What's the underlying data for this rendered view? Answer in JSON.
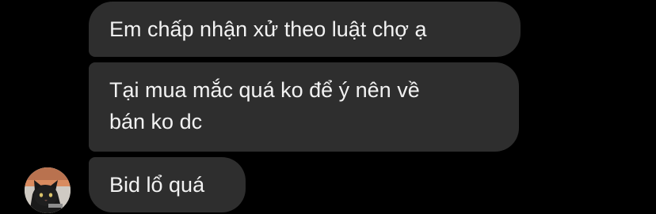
{
  "messages": [
    {
      "text": "Em chấp nhận xử theo luật chợ ạ"
    },
    {
      "lines": [
        "Tại mua mắc quá ko để ý nên về",
        "bán ko dc"
      ]
    },
    {
      "text": "Bid lổ quá"
    }
  ],
  "sender": {
    "avatar_icon": "cat-avatar-icon"
  },
  "colors": {
    "background": "#000000",
    "bubble": "#2e2e2e",
    "text": "#f2f2f2"
  }
}
